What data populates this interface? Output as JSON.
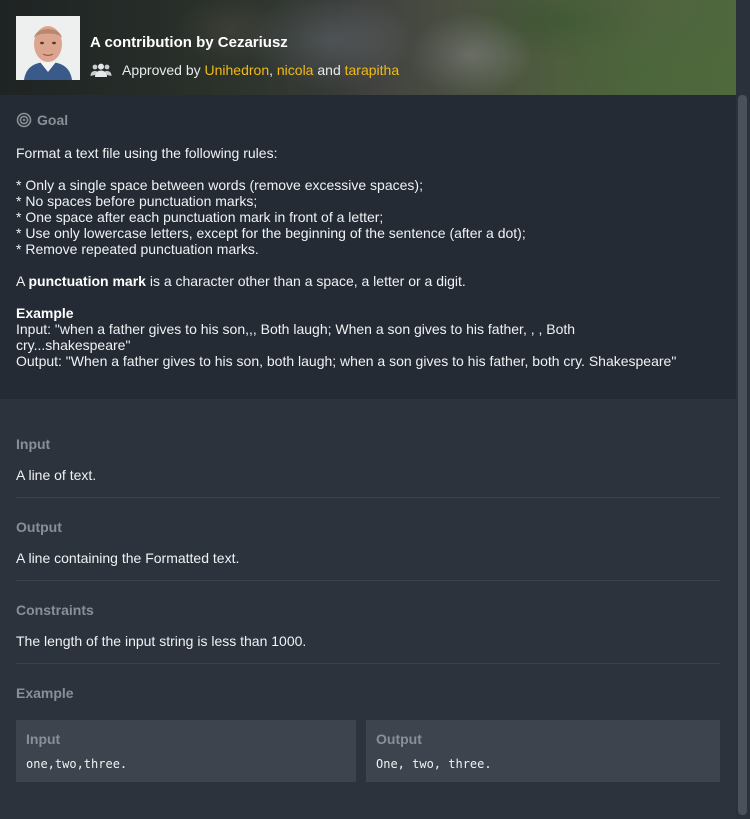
{
  "header": {
    "title": "A contribution by Cezariusz",
    "approved_prefix": "Approved by",
    "approvers": [
      "Unihedron",
      "nicola",
      "tarapitha"
    ],
    "sep_comma": ",",
    "sep_and": "and",
    "accent_color": "#f2bb13"
  },
  "goal": {
    "label": "Goal",
    "intro": "Format a text file using the following rules:",
    "rules": [
      "* Only a single space between words (remove excessive spaces);",
      "* No spaces before punctuation marks;",
      "* One space after each punctuation mark in front of a letter;",
      "* Use only lowercase letters, except for the beginning of the sentence (after a dot);",
      "* Remove repeated punctuation marks."
    ],
    "def_prefix": "A",
    "def_bold": "punctuation mark",
    "def_suffix": "is a character other than a space, a letter or a digit.",
    "example_heading": "Example",
    "example_input_line1": "Input: \"when a father gives to his son,,, Both laugh; When a son gives to his father, , , Both",
    "example_input_line2": "cry...shakespeare\"",
    "example_output": "Output: \"When a father gives to his son, both laugh; when a son gives to his father, both cry. Shakespeare\""
  },
  "sections": {
    "input_label": "Input",
    "input_text": "A line of text.",
    "output_label": "Output",
    "output_text": "A line containing the Formatted text.",
    "constraints_label": "Constraints",
    "constraints_text": "The length of the input string is less than 1000.",
    "example_label": "Example"
  },
  "example_boxes": {
    "input_label": "Input",
    "input_value": "one,two,three.",
    "output_label": "Output",
    "output_value": "One, two, three."
  }
}
